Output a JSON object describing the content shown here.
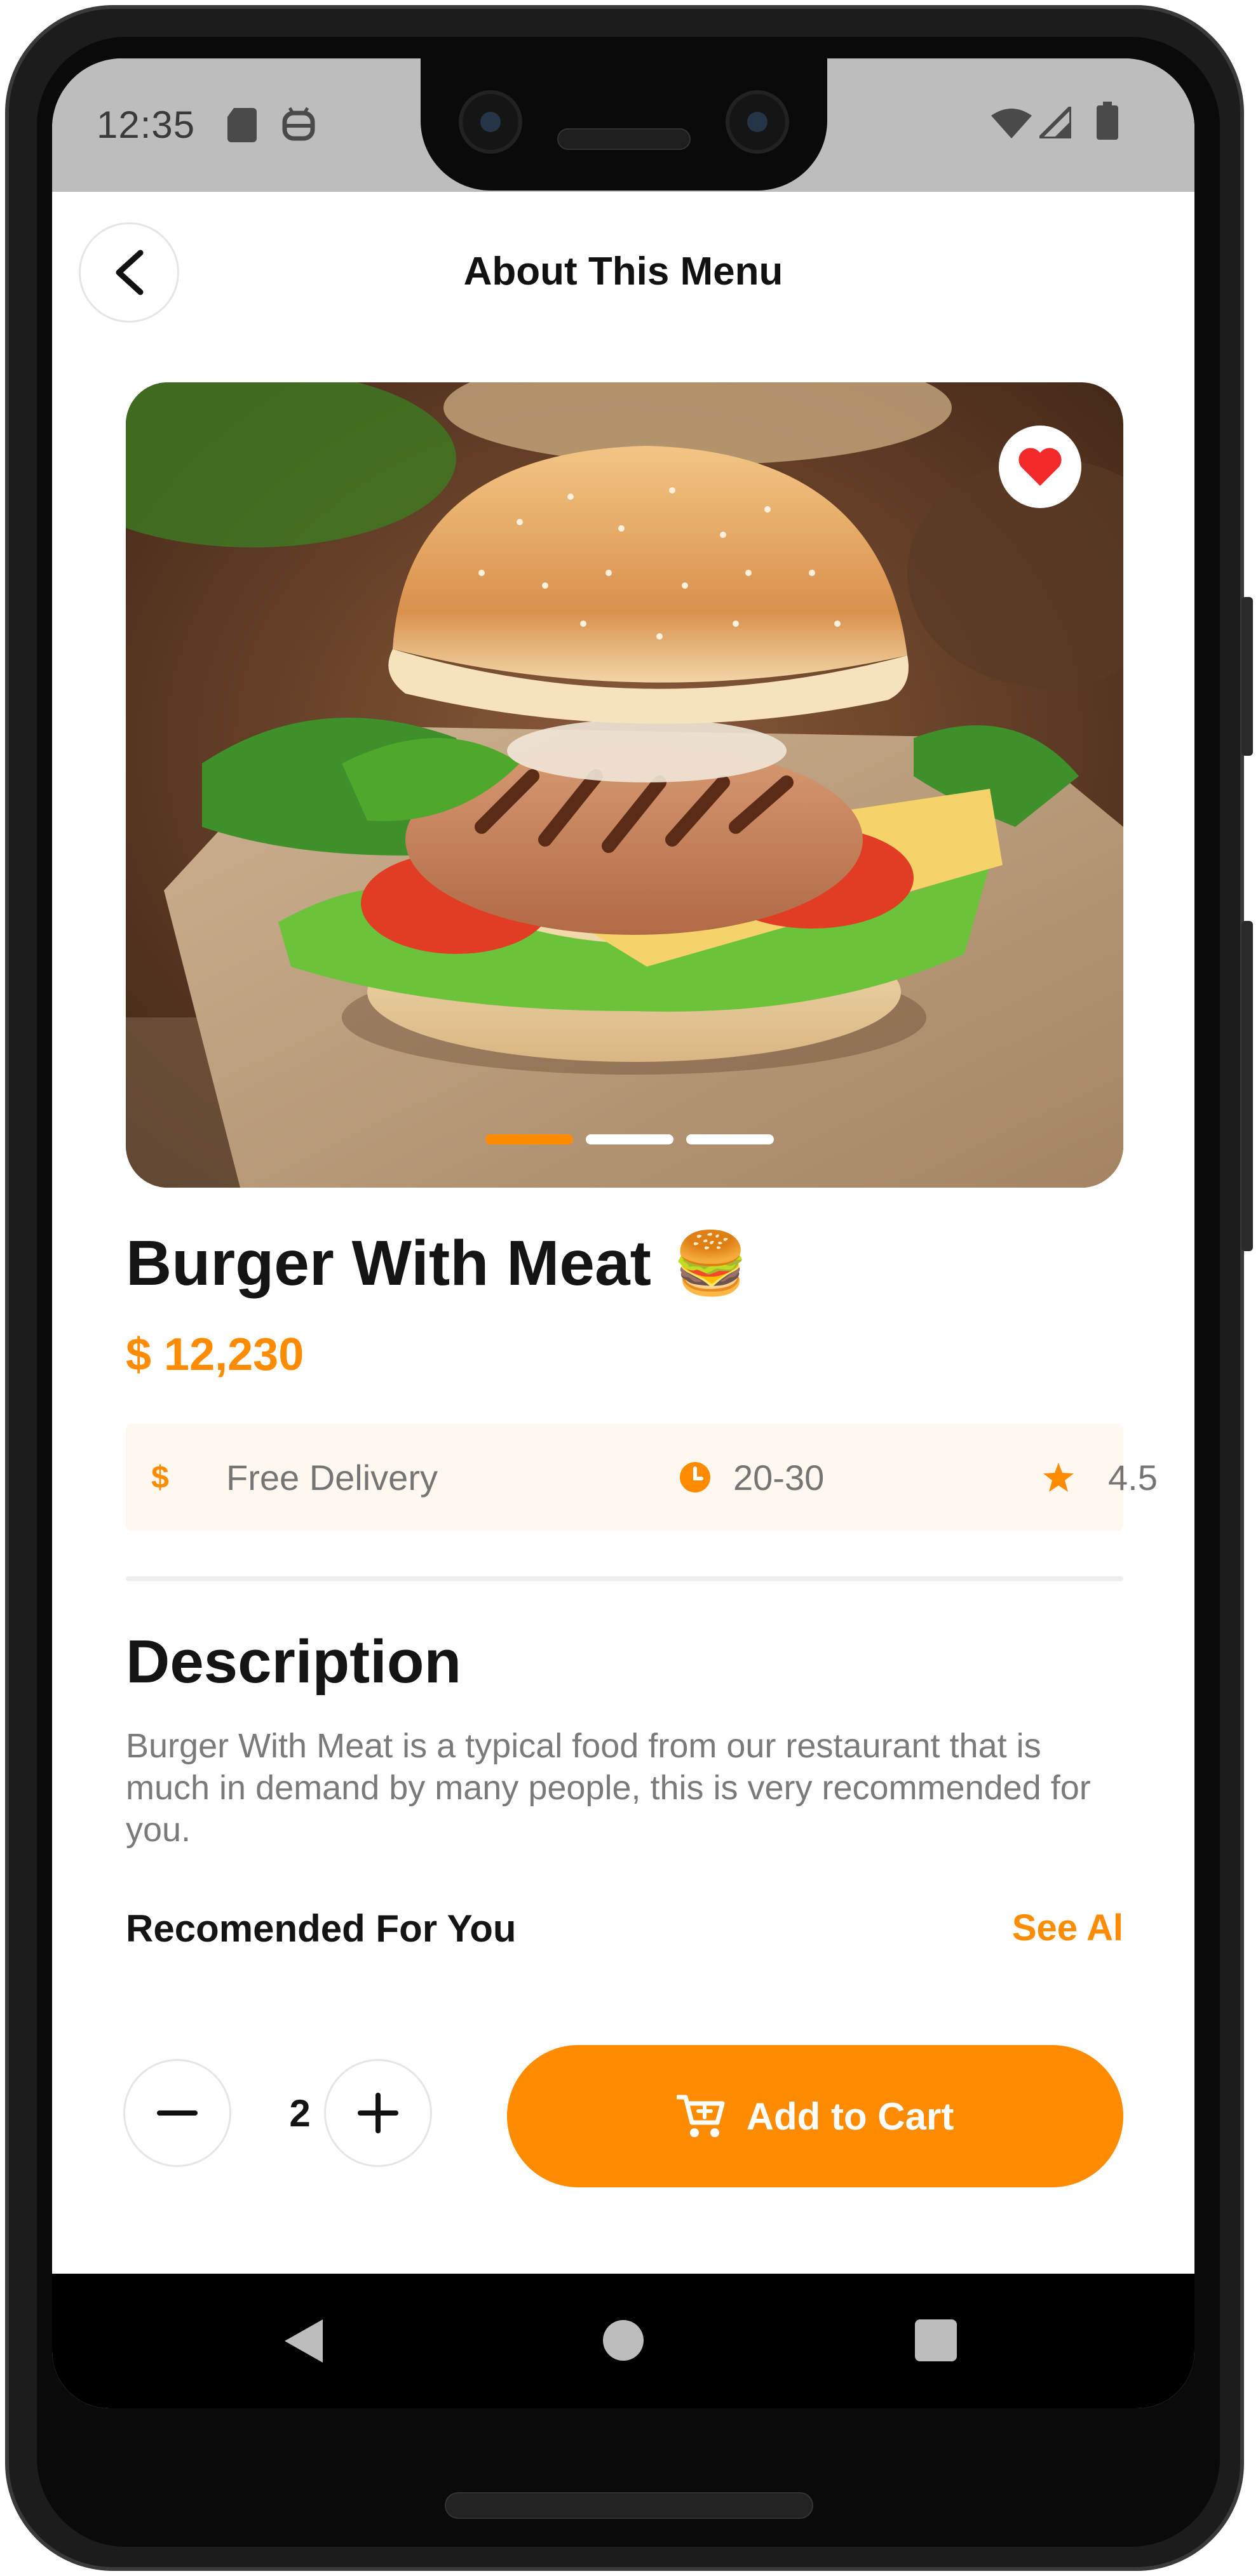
{
  "status_bar": {
    "time": "12:35",
    "icons": [
      "sd-card-icon",
      "android-debug-icon",
      "wifi-icon",
      "cell-signal-icon",
      "battery-icon"
    ]
  },
  "header": {
    "title": "About This Menu",
    "back_icon": "chevron-left-icon"
  },
  "product": {
    "image_alt": "burger-photo",
    "favorite_icon": "heart-icon",
    "carousel": {
      "count": 3,
      "active_index": 0
    },
    "name": "Burger With Meat",
    "name_emoji": "🍔",
    "price": "$ 12,230",
    "info": {
      "delivery": {
        "icon": "dollar-icon",
        "label": "Free Delivery"
      },
      "time": {
        "icon": "clock-icon",
        "label": "20-30"
      },
      "rating": {
        "icon": "star-icon",
        "label": "4.5"
      }
    }
  },
  "description": {
    "title": "Description",
    "text": "Burger With Meat is a typical food from our restaurant that is much in demand by many people, this is very recommended for you."
  },
  "recommended": {
    "title": "Recomended For You",
    "see_all": "See Al"
  },
  "cart": {
    "quantity": "2",
    "minus_icon": "minus-icon",
    "plus_icon": "plus-icon",
    "button_label": "Add to Cart",
    "button_icon": "cart-icon"
  },
  "navigation": {
    "back_icon": "nav-back-icon",
    "home_icon": "nav-home-icon",
    "recents_icon": "nav-recents-icon"
  },
  "colors": {
    "accent": "#ff8c00",
    "favorite": "#f22a2a",
    "text_primary": "#141414",
    "text_secondary": "#7a7a7a",
    "info_bg": "#fff8f0"
  }
}
